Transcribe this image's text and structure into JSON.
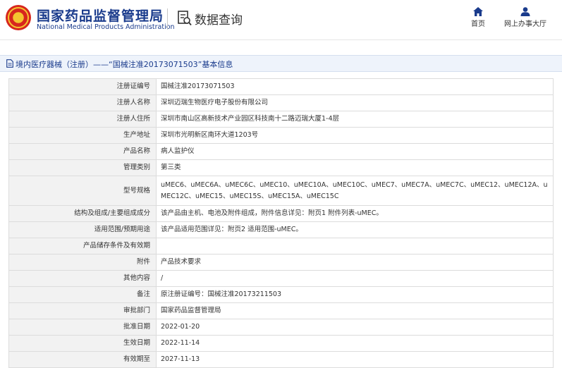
{
  "header": {
    "org_name_cn": "国家药品监督管理局",
    "org_name_en": "National Medical Products Administration",
    "page_title": "数据查询"
  },
  "nav": {
    "home_label": "首页",
    "hall_label": "网上办事大厅"
  },
  "section": {
    "title": "境内医疗器械（注册）——“国械注准20173071503”基本信息"
  },
  "rows": [
    {
      "label": "注册证编号",
      "value": "国械注准20173071503"
    },
    {
      "label": "注册人名称",
      "value": "深圳迈瑞生物医疗电子股份有限公司"
    },
    {
      "label": "注册人住所",
      "value": "深圳市南山区高新技术产业园区科技南十二路迈瑞大厦1-4层"
    },
    {
      "label": "生产地址",
      "value": "深圳市光明新区南环大道1203号"
    },
    {
      "label": "产品名称",
      "value": "病人监护仪"
    },
    {
      "label": "管理类别",
      "value": "第三类"
    },
    {
      "label": "型号规格",
      "value": "uMEC6、uMEC6A、uMEC6C、uMEC10、uMEC10A、uMEC10C、uMEC7、uMEC7A、uMEC7C、uMEC12、uMEC12A、uMEC12C、uMEC15、uMEC15S、uMEC15A、uMEC15C"
    },
    {
      "label": "结构及组成/主要组成成分",
      "value": "该产品由主机、电池及附件组成，附件信息详见：附页1 附件列表-uMEC。"
    },
    {
      "label": "适用范围/预期用途",
      "value": "该产品适用范围详见：附页2 适用范围-uMEC。"
    },
    {
      "label": "产品储存条件及有效期",
      "value": ""
    },
    {
      "label": "附件",
      "value": "产品技术要求"
    },
    {
      "label": "其他内容",
      "value": "/"
    },
    {
      "label": "备注",
      "value": "原注册证编号：国械注准20173211503"
    },
    {
      "label": "审批部门",
      "value": "国家药品监督管理局"
    },
    {
      "label": "批准日期",
      "value": "2022-01-20"
    },
    {
      "label": "生效日期",
      "value": "2022-11-14"
    },
    {
      "label": "有效期至",
      "value": "2027-11-13"
    }
  ],
  "icons": {
    "emblem": "national-emblem-icon",
    "query": "document-search-icon",
    "home": "home-icon",
    "hall": "user-icon",
    "section": "document-icon"
  },
  "colors": {
    "brand_blue": "#1a3b8c",
    "emblem_red": "#d7261e",
    "emblem_gold": "#f4c430",
    "label_bg": "#f2f2f2",
    "section_bg": "#eef3fb"
  }
}
